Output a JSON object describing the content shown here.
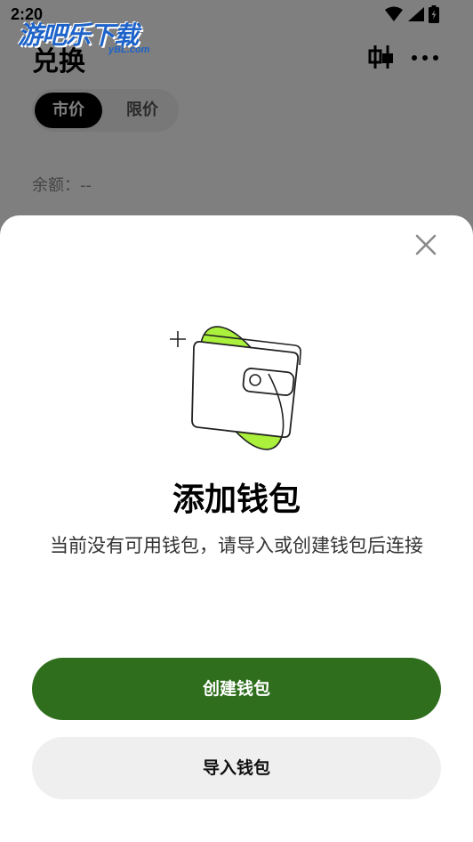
{
  "status_bar": {
    "time": "2:20"
  },
  "watermark": {
    "text": "游吧乐下载",
    "sub": "yBL.com"
  },
  "page": {
    "title": "兑换",
    "tabs": [
      {
        "label": "市价",
        "active": true
      },
      {
        "label": "限价",
        "active": false
      }
    ],
    "balance_label": "余额：--"
  },
  "sheet": {
    "title": "添加钱包",
    "description": "当前没有可用钱包，请导入或创建钱包后连接",
    "create_button": "创建钱包",
    "import_button": "导入钱包"
  },
  "colors": {
    "primary": "#2e6e1c",
    "accent": "#aaf03c",
    "secondary_button": "#efefef",
    "watermark": "#1d63c9"
  },
  "icons": [
    "wifi-icon",
    "signal-icon",
    "battery-icon",
    "kline-chart-icon",
    "more-icon",
    "close-icon",
    "wallet-illustration"
  ]
}
